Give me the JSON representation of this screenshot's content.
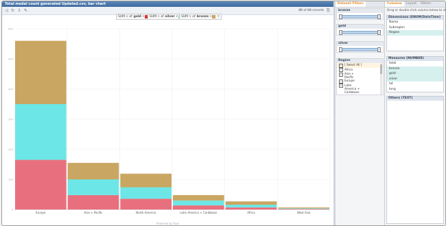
{
  "window": {
    "title": "Total medal count generated Updated.csv, bar chart"
  },
  "toolbar": {
    "records_label": "88 of 88 records",
    "icons": [
      "back-icon",
      "cycle-icon",
      "download-icon",
      "settings-icon"
    ]
  },
  "measures": [
    {
      "agg": "SUM",
      "of": "of",
      "field": "gold",
      "color": "#e0313a"
    },
    {
      "agg": "SUM",
      "of": "of",
      "field": "silver",
      "color": "#5fe0e0"
    },
    {
      "agg": "SUM",
      "of": "of",
      "field": "bronze",
      "color": "#c9a45c"
    }
  ],
  "chart_data": {
    "type": "bar",
    "stacked": true,
    "categories": [
      "Europe",
      "Asia + Pacific",
      "North America",
      "Latin America + Caribbean",
      "Africa",
      "West Asia"
    ],
    "series": [
      {
        "name": "gold",
        "color": "#e8707e",
        "values": [
          165,
          48,
          36,
          14,
          7,
          2
        ]
      },
      {
        "name": "silver",
        "color": "#6ce6e6",
        "values": [
          185,
          52,
          38,
          16,
          9,
          2
        ]
      },
      {
        "name": "bronze",
        "color": "#c9a661",
        "values": [
          210,
          55,
          45,
          18,
          11,
          3
        ]
      }
    ],
    "ylim": [
      0,
      600
    ],
    "yticks": [
      0,
      100,
      200,
      300,
      400,
      500,
      600
    ],
    "grid": true
  },
  "footer": {
    "text": "Powered by Raw"
  },
  "filters_panel": {
    "tabs": [
      "Dataset Filters"
    ],
    "sections": [
      {
        "label": "bronze"
      },
      {
        "label": "gold"
      },
      {
        "label": "silver"
      }
    ],
    "region": {
      "label": "Region",
      "items": [
        "[ Select All ]",
        "Africa",
        "Asia + Pacific",
        "Europe",
        "Latin America + Caribbean"
      ]
    }
  },
  "right_panel": {
    "tabs": [
      "Columns",
      "Layout",
      "Others"
    ],
    "hint": "Drag or double-click column below to start",
    "dimensions": {
      "label": "Dimensions (ENUM/DateTime)",
      "items": [
        "Name",
        "Subregion",
        "Region"
      ]
    },
    "measures": {
      "label": "Measures (NUMBER)",
      "items": [
        "total",
        "bronze",
        "gold",
        "silver",
        "lat",
        "long"
      ]
    },
    "others": {
      "label": "Others (TEXT)"
    }
  }
}
